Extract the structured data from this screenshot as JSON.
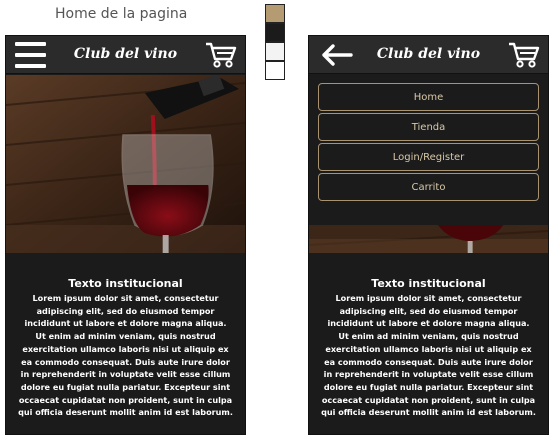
{
  "page_title": "Home de la pagina",
  "palette": [
    "#b59b72",
    "#1b1b1b",
    "#f3f3f3",
    "#ffffff"
  ],
  "brand": "Club del vino",
  "menu_items": [
    "Home",
    "Tienda",
    "Login/Register",
    "Carrito"
  ],
  "content": {
    "heading": "Texto institucional",
    "body": "Lorem ipsum dolor sit amet, consectetur adipiscing elit, sed do eiusmod tempor incididunt ut labore et dolore magna aliqua. Ut enim ad minim veniam, quis nostrud exercitation ullamco laboris nisi ut aliquip ex ea commodo consequat. Duis aute irure dolor in reprehenderit in voluptate velit esse cillum dolore eu fugiat nulla pariatur. Excepteur sint occaecat cupidatat non proident, sunt in culpa qui officia deserunt mollit anim id est laborum."
  },
  "icons": {
    "menu": "hamburger-icon",
    "back": "arrow-left-icon",
    "cart": "cart-icon"
  }
}
